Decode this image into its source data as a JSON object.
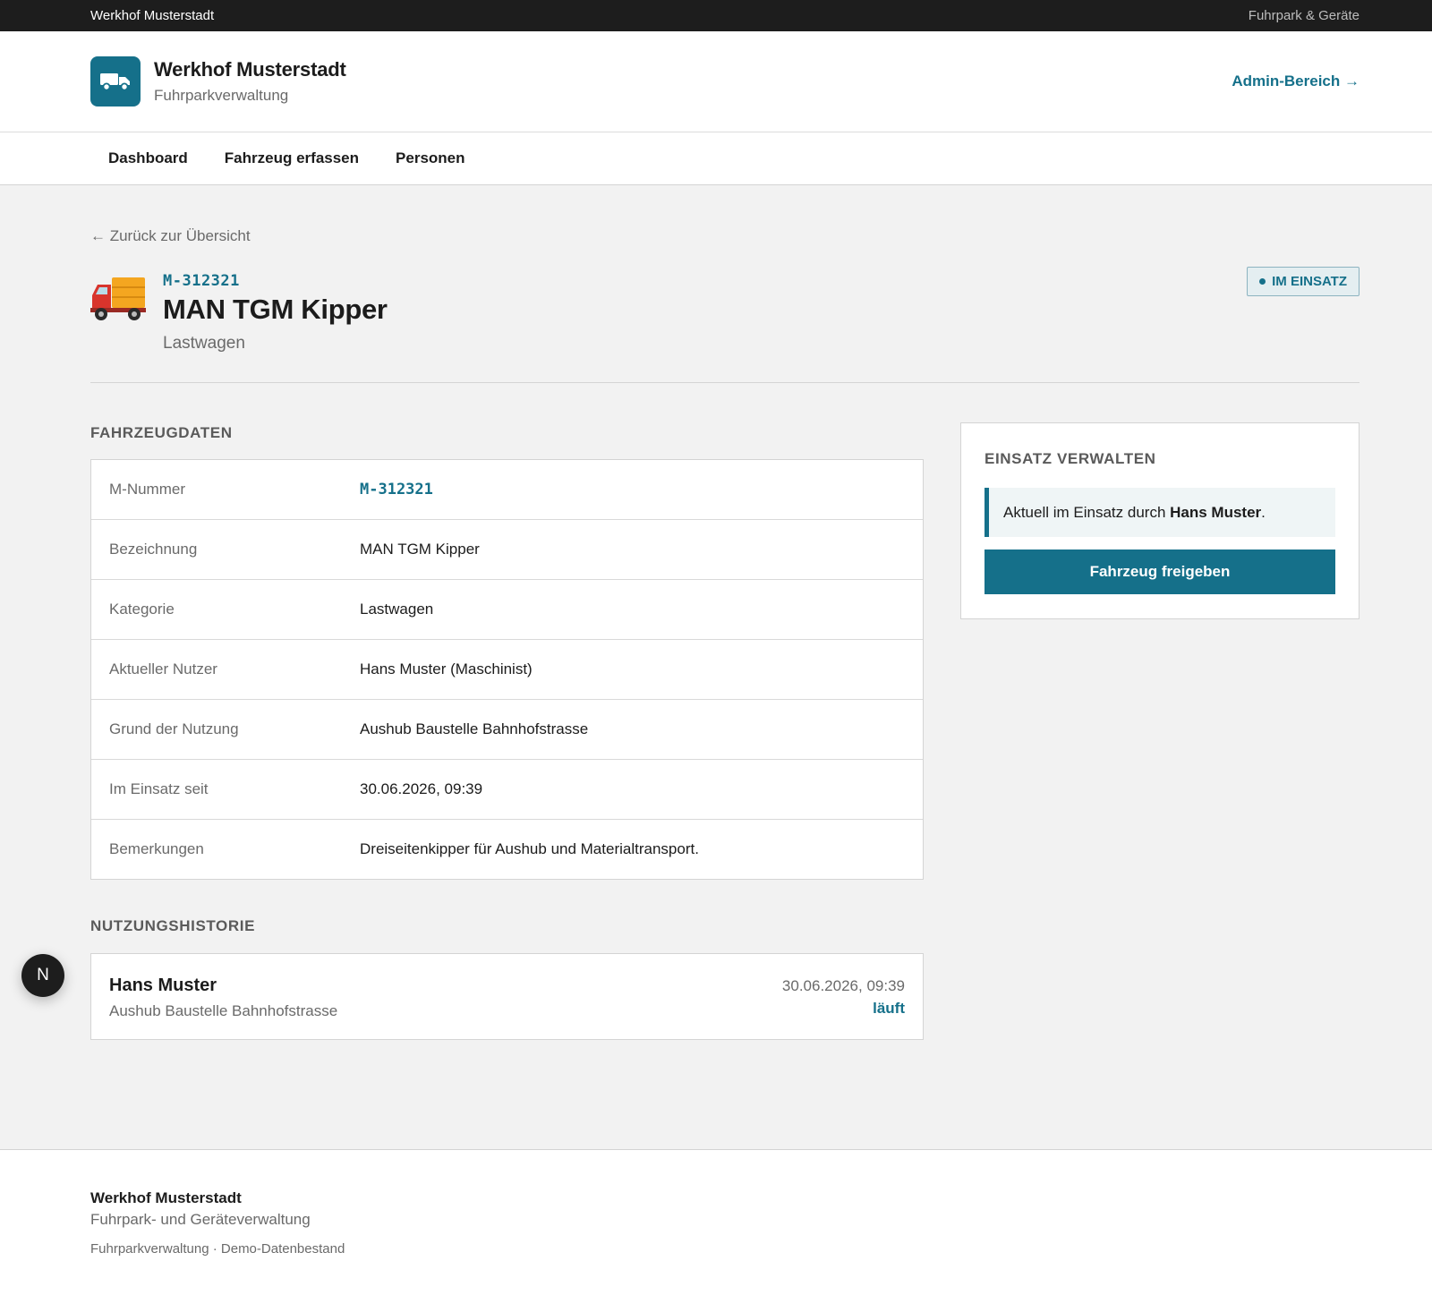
{
  "topbar": {
    "left": "Werkhof Musterstadt",
    "right": "Fuhrpark & Geräte"
  },
  "header": {
    "title": "Werkhof Musterstadt",
    "subtitle": "Fuhrparkverwaltung",
    "admin_link": "Admin-Bereich →",
    "logo_icon": "truck-icon"
  },
  "nav": {
    "items": [
      {
        "label": "Dashboard"
      },
      {
        "label": "Fahrzeug erfassen"
      },
      {
        "label": "Personen"
      }
    ]
  },
  "back_link": "← Zurück zur Übersicht",
  "vehicle": {
    "number": "M-312321",
    "name": "MAN TGM Kipper",
    "category": "Lastwagen",
    "status": "IM EINSATZ",
    "icon": "dump-truck-icon"
  },
  "details": {
    "title": "FAHRZEUGDATEN",
    "rows": [
      {
        "key": "M-Nummer",
        "value": "M-312321"
      },
      {
        "key": "Bezeichnung",
        "value": "MAN TGM Kipper"
      },
      {
        "key": "Kategorie",
        "value": "Lastwagen"
      },
      {
        "key": "Aktueller Nutzer",
        "value": "Hans Muster (Maschinist)"
      },
      {
        "key": "Grund der Nutzung",
        "value": "Aushub Baustelle Bahnhofstrasse"
      },
      {
        "key": "Im Einsatz seit",
        "value": "30.06.2026, 09:39"
      },
      {
        "key": "Bemerkungen",
        "value": "Dreiseitenkipper für Aushub und Materialtransport."
      }
    ]
  },
  "history": {
    "title": "NUTZUNGSHISTORIE",
    "entries": [
      {
        "name": "Hans Muster",
        "reason": "Aushub Baustelle Bahnhofstrasse",
        "time": "30.06.2026, 09:39",
        "status": "läuft"
      }
    ]
  },
  "panel": {
    "title": "EINSATZ VERWALTEN",
    "note_prefix": "Aktuell im Einsatz durch ",
    "note_person": "Hans Muster",
    "note_suffix": ".",
    "button": "Fahrzeug freigeben"
  },
  "float_button": {
    "label": "N"
  },
  "footer": {
    "title": "Werkhof Musterstadt",
    "subtitle": "Fuhrpark- und Geräteverwaltung",
    "meta": "Fuhrparkverwaltung · Demo-Datenbestand"
  },
  "colors": {
    "accent": "#15708a",
    "topbar": "#1d1d1d",
    "background": "#f2f2f2"
  }
}
